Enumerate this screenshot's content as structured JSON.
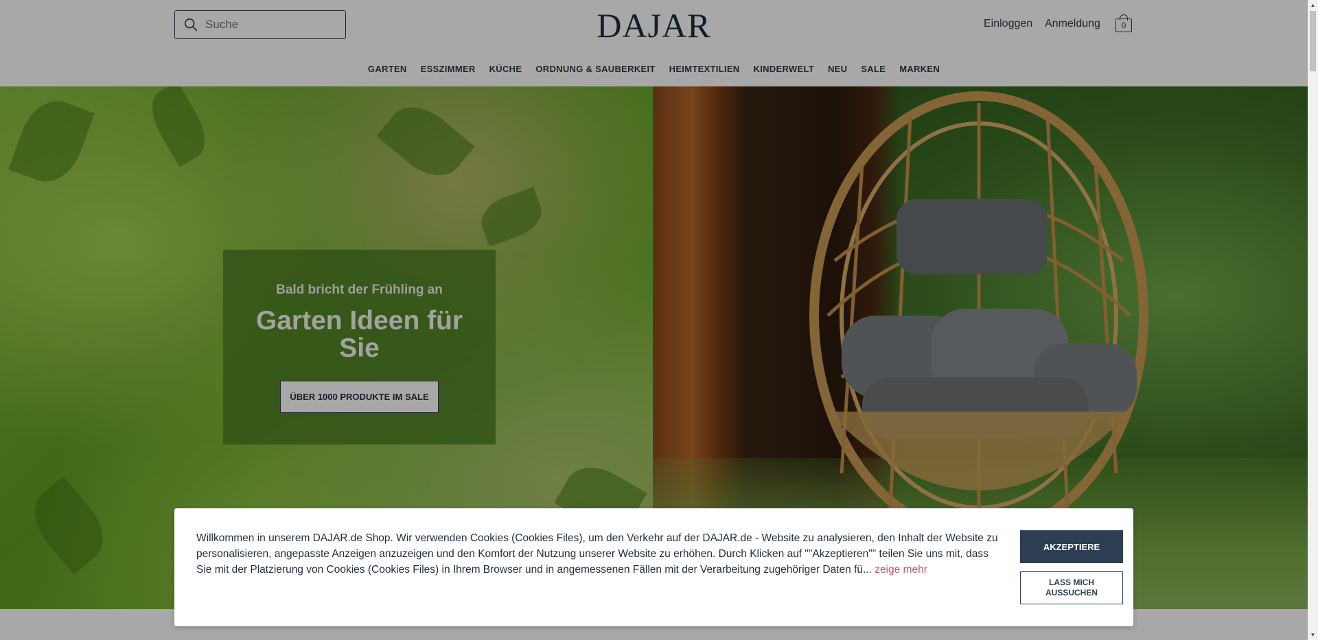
{
  "header": {
    "search_placeholder": "Suche",
    "logo": "DAJAR",
    "login_label": "Einloggen",
    "register_label": "Anmeldung",
    "cart_count": "0"
  },
  "nav": {
    "items": [
      "GARTEN",
      "ESSZIMMER",
      "KÜCHE",
      "ORDNUNG & SAUBERKEIT",
      "HEIMTEXTILIEN",
      "KINDERWELT",
      "NEU",
      "SALE",
      "MARKEN"
    ]
  },
  "hero": {
    "subtitle": "Bald bricht der Frühling an",
    "title": "Garten Ideen für Sie",
    "button_label": "ÜBER 1000 PRODUKTE IM SALE"
  },
  "cookie": {
    "text": "Willkommen in unserem DAJAR.de Shop. Wir verwenden Cookies (Cookies Files), um den Verkehr auf der DAJAR.de - Website zu analysieren, den Inhalt der Website zu personalisieren, angepasste Anzeigen anzuzeigen und den Komfort der Nutzung unserer Website zu erhöhen. Durch Klicken auf \"\"Akzeptieren\"\" teilen Sie uns mit, dass Sie mit der Platzierung von Cookies (Cookies Files) in Ihrem Browser und in angemessenen Fällen mit der Verarbeitung zugehöriger Daten fü...",
    "more_label": "zeige mehr",
    "accept_label": "AKZEPTIERE",
    "choose_label": "LASS MICH AUSSUCHEN"
  },
  "colors": {
    "brand_dark": "#2d3e52",
    "link_pink": "#c0557a",
    "promo_green": "#4b7d23"
  }
}
